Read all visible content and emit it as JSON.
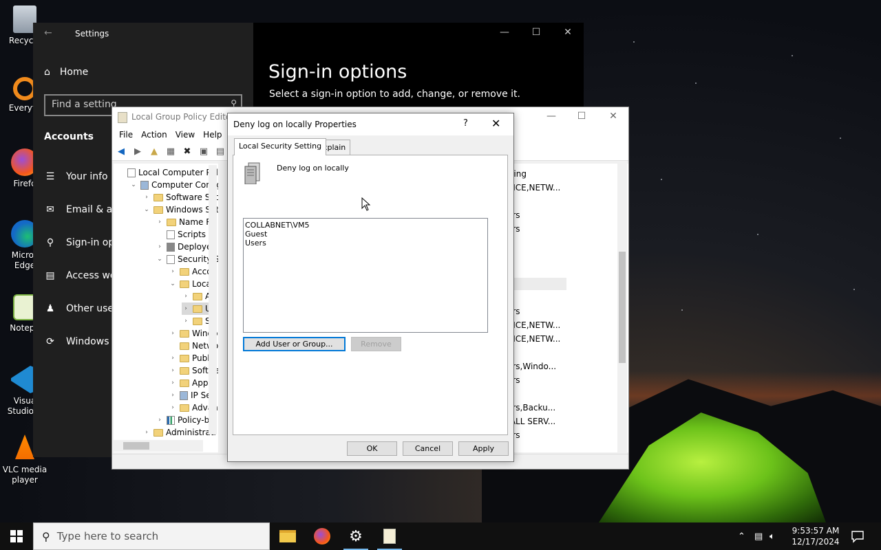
{
  "desktop": {
    "icons": [
      {
        "label": "Recycle"
      },
      {
        "label": "Everyth"
      },
      {
        "label": "Firefo"
      },
      {
        "label": "Micros Edge"
      },
      {
        "label": "Notepa"
      },
      {
        "label": "Visua Studio C"
      },
      {
        "label": "VLC media player"
      }
    ]
  },
  "settings": {
    "title": "Settings",
    "home": "Home",
    "find_placeholder": "Find a setting",
    "section": "Accounts",
    "nav": [
      "Your info",
      "Email & acc",
      "Sign-in opt",
      "Access wor",
      "Other users",
      "Windows b"
    ],
    "heading": "Sign-in options",
    "subheading": "Select a sign-in option to add, change, or remove it."
  },
  "gpe": {
    "title": "Local Group Policy Edito",
    "menu": [
      "File",
      "Action",
      "View",
      "Help"
    ],
    "tree": [
      {
        "label": "Local Computer Pol",
        "indent": 0,
        "arrow": "",
        "icon": "doc"
      },
      {
        "label": "Computer Config",
        "indent": 1,
        "arrow": "v",
        "icon": "pc"
      },
      {
        "label": "Software Set",
        "indent": 2,
        "arrow": ">",
        "icon": "folder"
      },
      {
        "label": "Windows Set",
        "indent": 2,
        "arrow": "v",
        "icon": "folder"
      },
      {
        "label": "Name Re",
        "indent": 3,
        "arrow": ">",
        "icon": "folder"
      },
      {
        "label": "Scripts (S",
        "indent": 3,
        "arrow": "",
        "icon": "doc"
      },
      {
        "label": "Deployed",
        "indent": 3,
        "arrow": ">",
        "icon": "printer"
      },
      {
        "label": "Security S",
        "indent": 3,
        "arrow": "v",
        "icon": "doc"
      },
      {
        "label": "Accou",
        "indent": 4,
        "arrow": ">",
        "icon": "folder"
      },
      {
        "label": "Local",
        "indent": 4,
        "arrow": "v",
        "icon": "folder"
      },
      {
        "label": "Au",
        "indent": 5,
        "arrow": ">",
        "icon": "folder"
      },
      {
        "label": "Us",
        "indent": 5,
        "arrow": ">",
        "icon": "folder",
        "selected": true
      },
      {
        "label": "Se",
        "indent": 5,
        "arrow": ">",
        "icon": "folder"
      },
      {
        "label": "Windo",
        "indent": 4,
        "arrow": ">",
        "icon": "folder"
      },
      {
        "label": "Netwo",
        "indent": 4,
        "arrow": "",
        "icon": "folder"
      },
      {
        "label": "Public",
        "indent": 4,
        "arrow": ">",
        "icon": "folder"
      },
      {
        "label": "Softwa",
        "indent": 4,
        "arrow": ">",
        "icon": "folder"
      },
      {
        "label": "Applic",
        "indent": 4,
        "arrow": ">",
        "icon": "folder"
      },
      {
        "label": "IP Sec",
        "indent": 4,
        "arrow": ">",
        "icon": "pc"
      },
      {
        "label": "Advan",
        "indent": 4,
        "arrow": ">",
        "icon": "folder"
      },
      {
        "label": "Policy-ba",
        "indent": 3,
        "arrow": ">",
        "icon": "chart"
      },
      {
        "label": "Administrati",
        "indent": 2,
        "arrow": ">",
        "icon": "folder"
      }
    ],
    "right_rows": [
      "tting",
      "VICE,NETW...",
      "",
      "ors",
      "ors",
      "",
      "",
      "",
      "",
      "",
      "ors",
      "VICE,NETW...",
      "VICE,NETW...",
      "",
      "ors,Windo...",
      "ors",
      "",
      "ors,Backu...",
      ",ALL SERV...",
      "ors"
    ]
  },
  "dialog": {
    "title": "Deny log on locally Properties",
    "help": "?",
    "tabs": [
      "Local Security Setting",
      "Explain"
    ],
    "policy_name": "Deny log on locally",
    "entries": [
      "COLLABNET\\VM5",
      "Guest",
      "Users"
    ],
    "add_button": "Add User or Group...",
    "remove_button": "Remove",
    "ok": "OK",
    "cancel": "Cancel",
    "apply": "Apply"
  },
  "taskbar": {
    "search_placeholder": "Type here to search",
    "time": "9:53:57 AM",
    "date": "12/17/2024"
  }
}
